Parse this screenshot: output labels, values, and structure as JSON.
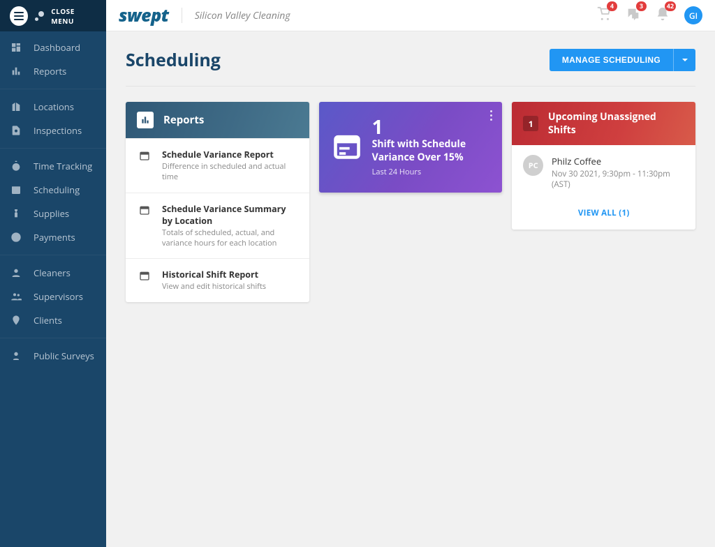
{
  "sidebar": {
    "close_label": "CLOSE MENU",
    "items": [
      {
        "label": "Dashboard",
        "icon": "dashboard-icon"
      },
      {
        "label": "Reports",
        "icon": "bar-chart-icon"
      },
      {
        "label": "Locations",
        "icon": "building-icon"
      },
      {
        "label": "Inspections",
        "icon": "magnify-doc-icon"
      },
      {
        "label": "Time Tracking",
        "icon": "stopwatch-icon"
      },
      {
        "label": "Scheduling",
        "icon": "calendar-icon"
      },
      {
        "label": "Supplies",
        "icon": "spray-bottle-icon"
      },
      {
        "label": "Payments",
        "icon": "dollar-icon"
      },
      {
        "label": "Cleaners",
        "icon": "person-icon"
      },
      {
        "label": "Supervisors",
        "icon": "people-icon"
      },
      {
        "label": "Clients",
        "icon": "pin-icon"
      },
      {
        "label": "Public Surveys",
        "icon": "survey-icon"
      }
    ]
  },
  "header": {
    "logo_text": "swept",
    "org_name": "Silicon Valley Cleaning",
    "badges": {
      "cart": "4",
      "messages": "3",
      "alerts": "42"
    },
    "avatar_initials": "GI"
  },
  "page": {
    "title": "Scheduling",
    "manage_button": "MANAGE SCHEDULING"
  },
  "reports_card": {
    "title": "Reports",
    "items": [
      {
        "title": "Schedule Variance Report",
        "sub": "Difference in scheduled and actual time"
      },
      {
        "title": "Schedule Variance Summary by Location",
        "sub": "Totals of scheduled, actual, and variance hours for each location"
      },
      {
        "title": "Historical Shift Report",
        "sub": "View and edit historical shifts"
      }
    ]
  },
  "variance_card": {
    "count": "1",
    "line1": "Shift with Schedule Variance Over 15%",
    "line2": "Last 24 Hours"
  },
  "unassigned_card": {
    "count": "1",
    "title": "Upcoming Unassigned Shifts",
    "shifts": [
      {
        "initials": "PC",
        "name": "Philz Coffee",
        "when": "Nov 30 2021, 9:30pm - 11:30pm (AST)"
      }
    ],
    "view_all": "VIEW ALL (1)"
  }
}
